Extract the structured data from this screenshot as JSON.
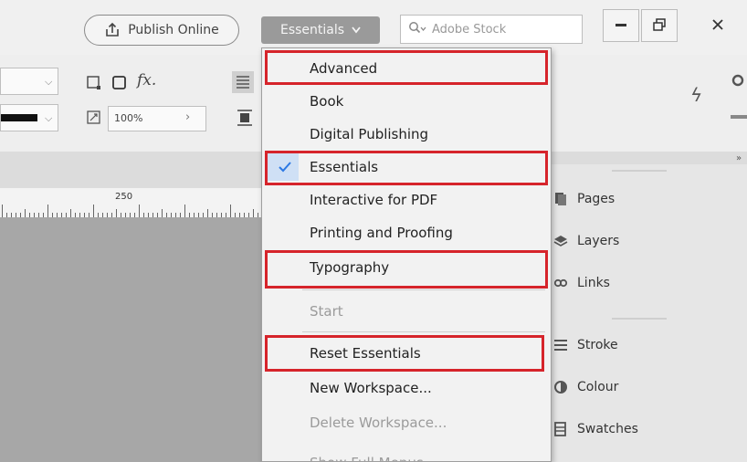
{
  "topbar": {
    "publish_label": "Publish Online",
    "workspace_label": "Essentials",
    "search_placeholder": "Adobe Stock",
    "window_controls": [
      "minimize",
      "restore",
      "close"
    ]
  },
  "controlbar": {
    "zoom_value": "100%",
    "fx_label": "fx."
  },
  "ruler": {
    "label": "250"
  },
  "workspace_menu": {
    "items": [
      {
        "label": "Advanced",
        "checked": false,
        "disabled": false,
        "highlighted": true
      },
      {
        "label": "Book",
        "checked": false,
        "disabled": false,
        "highlighted": false
      },
      {
        "label": "Digital Publishing",
        "checked": false,
        "disabled": false,
        "highlighted": false
      },
      {
        "label": "Essentials",
        "checked": true,
        "disabled": false,
        "highlighted": true
      },
      {
        "label": "Interactive for PDF",
        "checked": false,
        "disabled": false,
        "highlighted": false
      },
      {
        "label": "Printing and Proofing",
        "checked": false,
        "disabled": false,
        "highlighted": false
      },
      {
        "label": "Typography",
        "checked": false,
        "disabled": false,
        "highlighted": true
      },
      {
        "label": "Start",
        "checked": false,
        "disabled": true,
        "highlighted": false
      },
      {
        "label": "Reset Essentials",
        "checked": false,
        "disabled": false,
        "highlighted": true
      },
      {
        "label": "New Workspace...",
        "checked": false,
        "disabled": false,
        "highlighted": false
      },
      {
        "label": "Delete Workspace...",
        "checked": false,
        "disabled": true,
        "highlighted": false
      },
      {
        "label": "Show Full Menus",
        "checked": false,
        "disabled": false,
        "highlighted": false
      }
    ],
    "highlight_color": "#d6242b",
    "check_color": "#2b78e4"
  },
  "right_panel": {
    "items": [
      {
        "label": "Pages",
        "icon": "pages-icon"
      },
      {
        "label": "Layers",
        "icon": "layers-icon"
      },
      {
        "label": "Links",
        "icon": "links-icon"
      },
      {
        "label": "Stroke",
        "icon": "stroke-icon"
      },
      {
        "label": "Colour",
        "icon": "colour-icon"
      },
      {
        "label": "Swatches",
        "icon": "swatches-icon"
      }
    ]
  }
}
